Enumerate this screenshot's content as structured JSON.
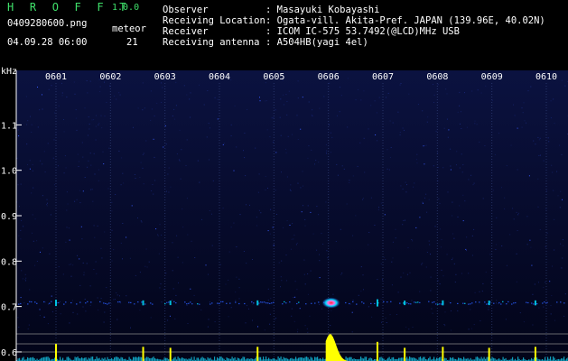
{
  "header": {
    "app_title": "H R O F F T",
    "app_version": "1.0.0",
    "filename": "0409280600.png",
    "datetime": "04.09.28 06:00",
    "meteor_label": "meteor",
    "meteor_count": "21"
  },
  "info": {
    "rows": [
      {
        "label": "Observer",
        "value": ": Masayuki Kobayashi"
      },
      {
        "label": "Receiving Location",
        "value": ": Ogata-vill. Akita-Pref. JAPAN (139.96E, 40.02N)"
      },
      {
        "label": "Receiver",
        "value": ": ICOM IC-575 53.7492(@LCD)MHz USB"
      },
      {
        "label": "Receiving antenna",
        "value": ": A504HB(yagi 4el)"
      }
    ]
  },
  "colors": {
    "header_green": "#3fe06a",
    "background_top": "#0b1240",
    "background_bottom": "#020418",
    "grid_line": "#3d4f8c",
    "signal_low": "#2a5cff",
    "signal_mid": "#00e0ff",
    "signal_high": "#ff2a2a",
    "histogram": "#ffff00",
    "histogram_fill": "#14c8e8"
  },
  "chart_data": {
    "type": "heatmap",
    "y_unit": "kHz",
    "y_ticks": [
      "1.1",
      "1.0",
      "0.9",
      "0.8",
      "0.7",
      "0.6"
    ],
    "y_tick_values": [
      1.1,
      1.0,
      0.9,
      0.8,
      0.7,
      0.6
    ],
    "ylim": [
      0.58,
      1.22
    ],
    "x_ticks": [
      "0601",
      "0602",
      "0603",
      "0604",
      "0605",
      "0606",
      "0607",
      "0608",
      "0609",
      "0610"
    ],
    "xlim": [
      0,
      10
    ],
    "carrier_khz": 0.71,
    "meteor_echoes": [
      {
        "minute": 0.0,
        "strength": 0.5
      },
      {
        "minute": 1.6,
        "strength": 0.35
      },
      {
        "minute": 2.1,
        "strength": 0.3
      },
      {
        "minute": 3.7,
        "strength": 0.35
      },
      {
        "minute": 5.05,
        "strength": 1.0
      },
      {
        "minute": 5.9,
        "strength": 0.6
      },
      {
        "minute": 6.4,
        "strength": 0.3
      },
      {
        "minute": 7.1,
        "strength": 0.35
      },
      {
        "minute": 7.95,
        "strength": 0.3
      },
      {
        "minute": 8.8,
        "strength": 0.35
      },
      {
        "minute": 9.5,
        "strength": 0.3
      }
    ]
  }
}
